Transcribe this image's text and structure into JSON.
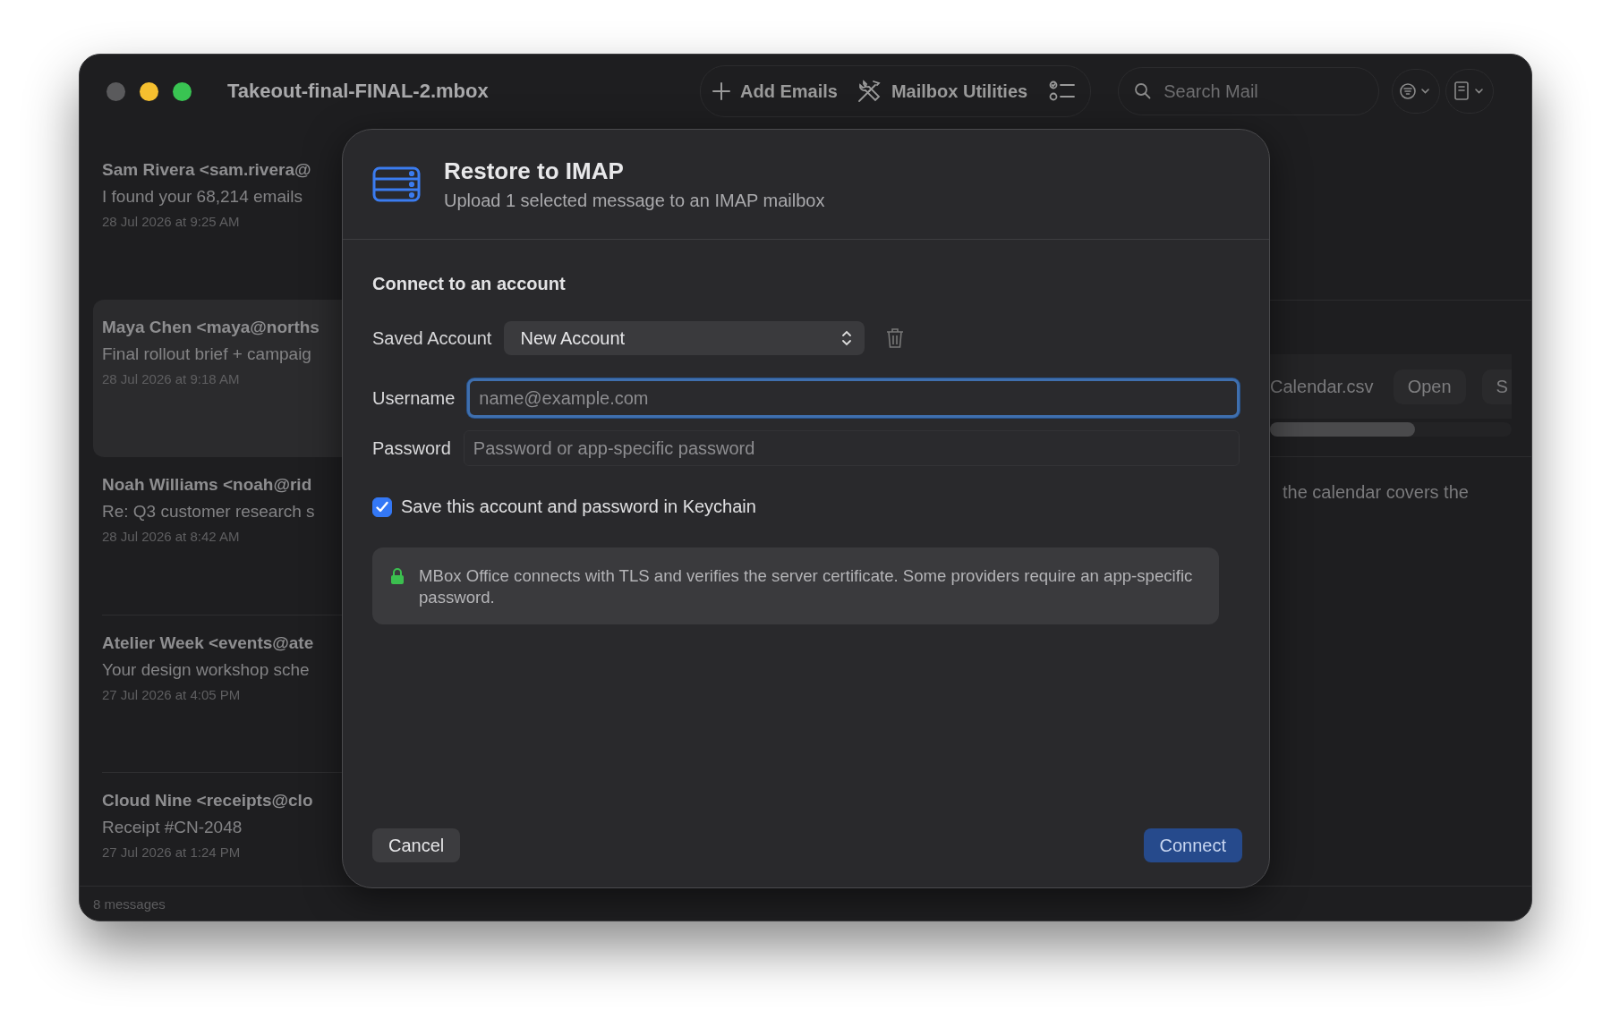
{
  "window": {
    "title": "Takeout-final-FINAL-2.mbox"
  },
  "toolbar": {
    "buttons": [
      {
        "label": "Add Emails",
        "kind": "add"
      },
      {
        "label": "Mailbox Utilities",
        "kind": "tools"
      }
    ]
  },
  "search": {
    "placeholder": "Search Mail"
  },
  "messages": [
    {
      "sender": "Sam Rivera <sam.rivera@",
      "subject": "I found your 68,214 emails",
      "date": "28 Jul 2026 at 9:25 AM",
      "selected": false
    },
    {
      "sender": "Maya Chen <maya@norths",
      "subject": "Final rollout brief + campaig",
      "date": "28 Jul 2026 at 9:18 AM",
      "selected": true
    },
    {
      "sender": "Noah Williams <noah@rid",
      "subject": "Re: Q3 customer research s",
      "date": "28 Jul 2026 at 8:42 AM",
      "selected": false
    },
    {
      "sender": "Atelier Week <events@ate",
      "subject": "Your design workshop sche",
      "date": "27 Jul 2026 at 4:05 PM",
      "selected": false
    },
    {
      "sender": "Cloud Nine <receipts@clo",
      "subject": "Receipt #CN-2048",
      "date": "27 Jul 2026 at 1:24 PM",
      "selected": false
    }
  ],
  "status_bar": "8 messages",
  "preview": {
    "attachment": {
      "name": "Calendar.csv",
      "buttons": [
        "Open",
        "S"
      ],
      "level": 0.6
    },
    "text": "the calendar covers the"
  },
  "dialog": {
    "title": "Restore to IMAP",
    "subtitle": "Upload 1 selected message to an IMAP mailbox",
    "section": "Connect to an account",
    "saved_account": {
      "label": "Saved Account",
      "value": "New Account"
    },
    "fields": [
      {
        "label": "Username",
        "placeholder": "name@example.com",
        "focused": true
      },
      {
        "label": "Password",
        "placeholder": "Password or app-specific password",
        "focused": false
      }
    ],
    "keychain": {
      "label": "Save this account and password in Keychain",
      "checked": true
    },
    "note": "MBox Office connects with TLS and verifies the server certificate. Some providers require an app-specific password.",
    "buttons": [
      {
        "label": "Cancel",
        "kind": "secondary"
      },
      {
        "label": "Connect",
        "kind": "primary"
      }
    ]
  }
}
